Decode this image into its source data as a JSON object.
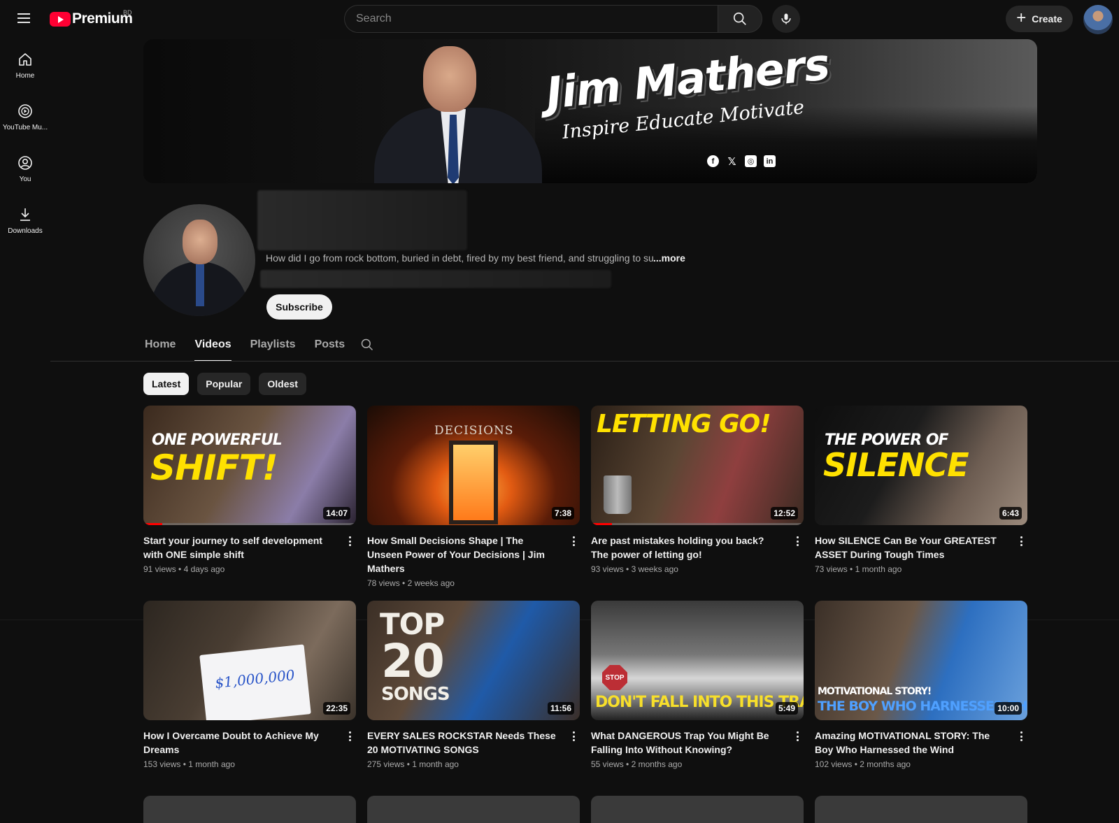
{
  "header": {
    "logo_text": "Premium",
    "region": "BD",
    "search_placeholder": "Search",
    "create_label": "Create"
  },
  "sidebar": {
    "items": [
      {
        "label": "Home",
        "icon": "home-icon"
      },
      {
        "label": "YouTube Mu...",
        "icon": "youtube-music-icon"
      },
      {
        "label": "You",
        "icon": "account-circle-icon"
      },
      {
        "label": "Downloads",
        "icon": "download-icon"
      }
    ]
  },
  "banner": {
    "title": "Jim Mathers",
    "tagline": "Inspire Educate Motivate",
    "social": [
      "facebook-icon",
      "x-icon",
      "instagram-icon",
      "linkedin-icon"
    ]
  },
  "channel": {
    "description": "How did I go from rock bottom, buried in debt, fired by my best friend, and struggling to su",
    "more_label": "...more",
    "subscribe_label": "Subscribe"
  },
  "tabs": [
    {
      "label": "Home",
      "active": false
    },
    {
      "label": "Videos",
      "active": true
    },
    {
      "label": "Playlists",
      "active": false
    },
    {
      "label": "Posts",
      "active": false
    }
  ],
  "chips": [
    {
      "label": "Latest",
      "active": true
    },
    {
      "label": "Popular",
      "active": false
    },
    {
      "label": "Oldest",
      "active": false
    }
  ],
  "videos": [
    {
      "title": "Start your journey to self development with ONE simple shift",
      "views": "91 views",
      "age": "4 days ago",
      "duration": "14:07",
      "thumb_text": [
        "ONE POWERFUL",
        "SHIFT!"
      ],
      "watched": 0.09
    },
    {
      "title": "How Small Decisions Shape | The Unseen Power of Your Decisions | Jim Mathers",
      "views": "78 views",
      "age": "2 weeks ago",
      "duration": "7:38",
      "thumb_text": [
        "DECISIONS"
      ],
      "watched": 0
    },
    {
      "title": "Are past mistakes holding you back? The power of letting go!",
      "views": "93 views",
      "age": "3 weeks ago",
      "duration": "12:52",
      "thumb_text": [
        "LETTING GO!"
      ],
      "watched": 0.1
    },
    {
      "title": "How SILENCE Can Be Your GREATEST ASSET During Tough Times",
      "views": "73 views",
      "age": "1 month ago",
      "duration": "6:43",
      "thumb_text": [
        "THE POWER OF",
        "SILENCE"
      ],
      "watched": 0
    },
    {
      "title": "How I Overcame Doubt to Achieve My Dreams",
      "views": "153 views",
      "age": "1 month ago",
      "duration": "22:35",
      "thumb_text": [
        "$1,000,000"
      ],
      "watched": 0
    },
    {
      "title": "EVERY SALES ROCKSTAR Needs These 20 MOTIVATING SONGS",
      "views": "275 views",
      "age": "1 month ago",
      "duration": "11:56",
      "thumb_text": [
        "TOP",
        "20",
        "SONGS"
      ],
      "watched": 0
    },
    {
      "title": "What DANGEROUS Trap You Might Be Falling Into Without Knowing?",
      "views": "55 views",
      "age": "2 months ago",
      "duration": "5:49",
      "thumb_text": [
        "STOP",
        "DON'T FALL INTO THIS TRAP"
      ],
      "watched": 0
    },
    {
      "title": "Amazing MOTIVATIONAL STORY: The Boy Who Harnessed the Wind",
      "views": "102 views",
      "age": "2 months ago",
      "duration": "10:00",
      "thumb_text": [
        "MOTIVATIONAL STORY!",
        "THE BOY WHO HARNESSED THE WIND"
      ],
      "watched": 0
    }
  ],
  "colors": {
    "background": "#0f0f0f",
    "accent": "#ff0033",
    "progress": "#ff0000"
  }
}
